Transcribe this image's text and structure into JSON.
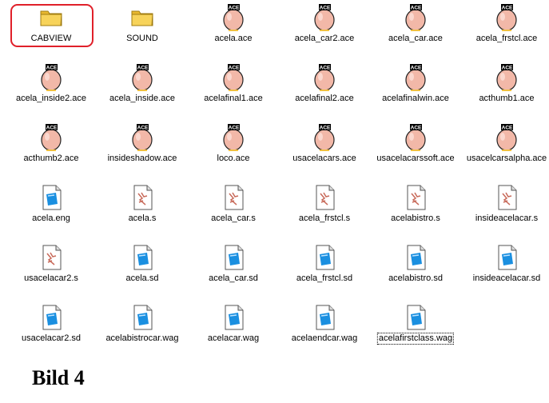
{
  "colors": {
    "selection_border": "#e0202a",
    "folder_yellow": "#f7d35a",
    "ace_egg": "#f2b8a8",
    "sd_blue": "#1a8fe0",
    "s_red": "#c86a5a"
  },
  "files": [
    {
      "name": "CABVIEW",
      "icon": "folder-icon",
      "selected": true
    },
    {
      "name": "SOUND",
      "icon": "folder-icon"
    },
    {
      "name": "acela.ace",
      "icon": "ace-file-icon"
    },
    {
      "name": "acela_car2.ace",
      "icon": "ace-file-icon"
    },
    {
      "name": "acela_car.ace",
      "icon": "ace-file-icon"
    },
    {
      "name": "acela_frstcl.ace",
      "icon": "ace-file-icon"
    },
    {
      "name": "acela_inside2.ace",
      "icon": "ace-file-icon"
    },
    {
      "name": "acela_inside.ace",
      "icon": "ace-file-icon"
    },
    {
      "name": "acelafinal1.ace",
      "icon": "ace-file-icon"
    },
    {
      "name": "acelafinal2.ace",
      "icon": "ace-file-icon"
    },
    {
      "name": "acelafinalwin.ace",
      "icon": "ace-file-icon"
    },
    {
      "name": "acthumb1.ace",
      "icon": "ace-file-icon"
    },
    {
      "name": "acthumb2.ace",
      "icon": "ace-file-icon"
    },
    {
      "name": "insideshadow.ace",
      "icon": "ace-file-icon"
    },
    {
      "name": "loco.ace",
      "icon": "ace-file-icon"
    },
    {
      "name": "usacelacars.ace",
      "icon": "ace-file-icon"
    },
    {
      "name": "usacelacarssoft.ace",
      "icon": "ace-file-icon"
    },
    {
      "name": "usacelcarsalpha.ace",
      "icon": "ace-file-icon"
    },
    {
      "name": "acela.eng",
      "icon": "eng-file-icon"
    },
    {
      "name": "acela.s",
      "icon": "s-file-icon"
    },
    {
      "name": "acela_car.s",
      "icon": "s-file-icon"
    },
    {
      "name": "acela_frstcl.s",
      "icon": "s-file-icon"
    },
    {
      "name": "acelabistro.s",
      "icon": "s-file-icon"
    },
    {
      "name": "insideacelacar.s",
      "icon": "s-file-icon"
    },
    {
      "name": "usacelacar2.s",
      "icon": "s-file-icon"
    },
    {
      "name": "acela.sd",
      "icon": "sd-file-icon"
    },
    {
      "name": "acela_car.sd",
      "icon": "sd-file-icon"
    },
    {
      "name": "acela_frstcl.sd",
      "icon": "sd-file-icon"
    },
    {
      "name": "acelabistro.sd",
      "icon": "sd-file-icon"
    },
    {
      "name": "insideacelacar.sd",
      "icon": "sd-file-icon"
    },
    {
      "name": "usacelacar2.sd",
      "icon": "sd-file-icon"
    },
    {
      "name": "acelabistrocar.wag",
      "icon": "wag-file-icon"
    },
    {
      "name": "acelacar.wag",
      "icon": "wag-file-icon"
    },
    {
      "name": "acelaendcar.wag",
      "icon": "wag-file-icon"
    },
    {
      "name": "acelafirstclass.wag",
      "icon": "wag-file-icon",
      "focused": true
    }
  ],
  "caption": "Bild 4"
}
